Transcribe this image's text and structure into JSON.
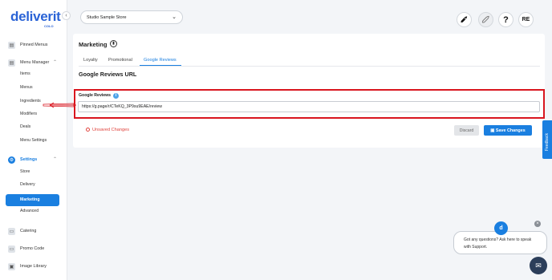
{
  "brand": {
    "name": "deliverit",
    "sub": "COLO"
  },
  "sidebar": {
    "collapse_icon": "‹",
    "items": [
      {
        "label": "Pinned Menus",
        "icon": "pin-icon"
      },
      {
        "label": "Menu Manager",
        "icon": "menu-icon",
        "chevron": "⌃"
      },
      {
        "label": "Items"
      },
      {
        "label": "Menus"
      },
      {
        "label": "Ingredients"
      },
      {
        "label": "Modifiers"
      },
      {
        "label": "Deals"
      },
      {
        "label": "Menu Settings"
      },
      {
        "label": "Settings",
        "icon": "gear-icon",
        "chevron": "⌃"
      },
      {
        "label": "Store"
      },
      {
        "label": "Delivery"
      },
      {
        "label": "Marketing"
      },
      {
        "label": "Advanced"
      },
      {
        "label": "Catering",
        "icon": "catering-icon"
      },
      {
        "label": "Promo Code",
        "icon": "promo-icon"
      },
      {
        "label": "Image Library",
        "icon": "image-icon"
      }
    ]
  },
  "topbar": {
    "store": "Studio Sample Store",
    "chevron": "⌄",
    "icons": [
      "rocket-icon",
      "rocket-icon-2",
      "help-icon"
    ],
    "help": "?",
    "user_initials": "RE"
  },
  "page": {
    "title": "Marketing",
    "tabs": [
      "Loyalty",
      "Promotional",
      "Google Reviews"
    ],
    "active_tab": "Google Reviews",
    "section_title": "Google Reviews URL",
    "field_label": "Google Reviews",
    "info": "i",
    "field_value": "https://g.page/r/CTeKQ_3P9su9EAE/review",
    "unsaved": "Unsaved Changes",
    "discard": "Discard",
    "save": "Save Changes"
  },
  "feedback": "Feedback",
  "chat": {
    "line1": "Got any questions? Ask here to speak",
    "line2": "with Support.",
    "avatar": "d",
    "close": "×",
    "launcher": "✉"
  },
  "colors": {
    "accent": "#1a7fe0",
    "highlight": "#d9161f",
    "warning": "#e0443e"
  }
}
